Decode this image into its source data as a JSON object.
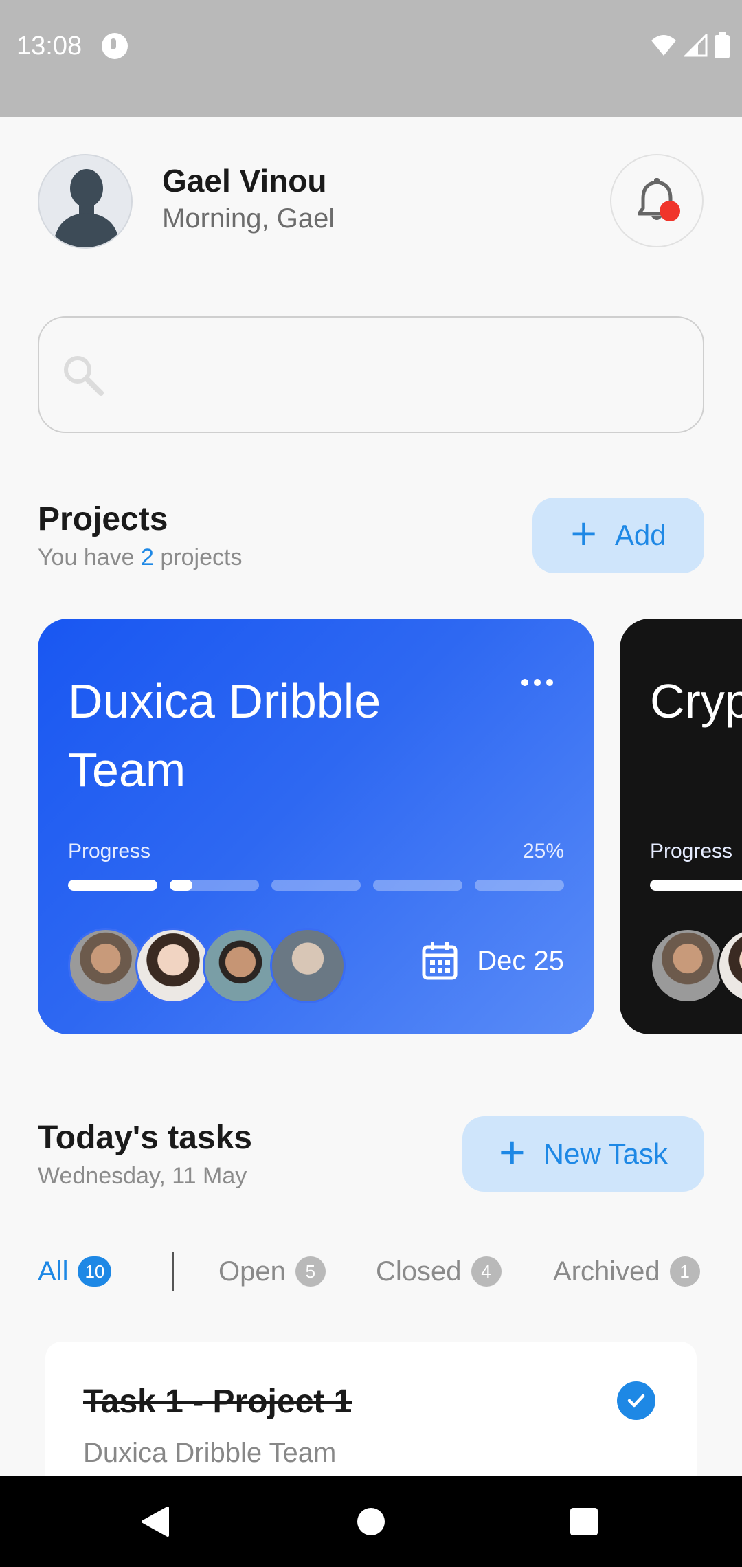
{
  "status_bar": {
    "time": "13:08"
  },
  "header": {
    "user_name": "Gael Vinou",
    "greeting": "Morning, Gael"
  },
  "search": {
    "placeholder": ""
  },
  "projects": {
    "title": "Projects",
    "subtitle_prefix": "You have",
    "count": "2",
    "subtitle_suffix": "projects",
    "add_label": "Add",
    "cards": [
      {
        "title": "Duxica Dribble Team",
        "progress_label": "Progress",
        "progress_text": "25%",
        "progress_value": 0.25,
        "due": "Dec 25",
        "members": [
          "member-1",
          "member-2",
          "member-3",
          "member-4"
        ]
      },
      {
        "title": "Cryp Redc",
        "progress_label": "Progress"
      }
    ]
  },
  "tasks": {
    "title": "Today's tasks",
    "date": "Wednesday, 11 May",
    "new_label": "New Task",
    "tabs": [
      {
        "label": "All",
        "count": "10"
      },
      {
        "label": "Open",
        "count": "5"
      },
      {
        "label": "Closed",
        "count": "4"
      },
      {
        "label": "Archived",
        "count": "1"
      }
    ],
    "items": [
      {
        "title": "Task 1 - Project 1",
        "project": "Duxica Dribble Team",
        "done": true
      }
    ]
  },
  "colors": {
    "accent": "#1e88e5",
    "card_blue": "#1957f2",
    "card_dark": "#141414",
    "notification_dot": "#f0352b"
  }
}
